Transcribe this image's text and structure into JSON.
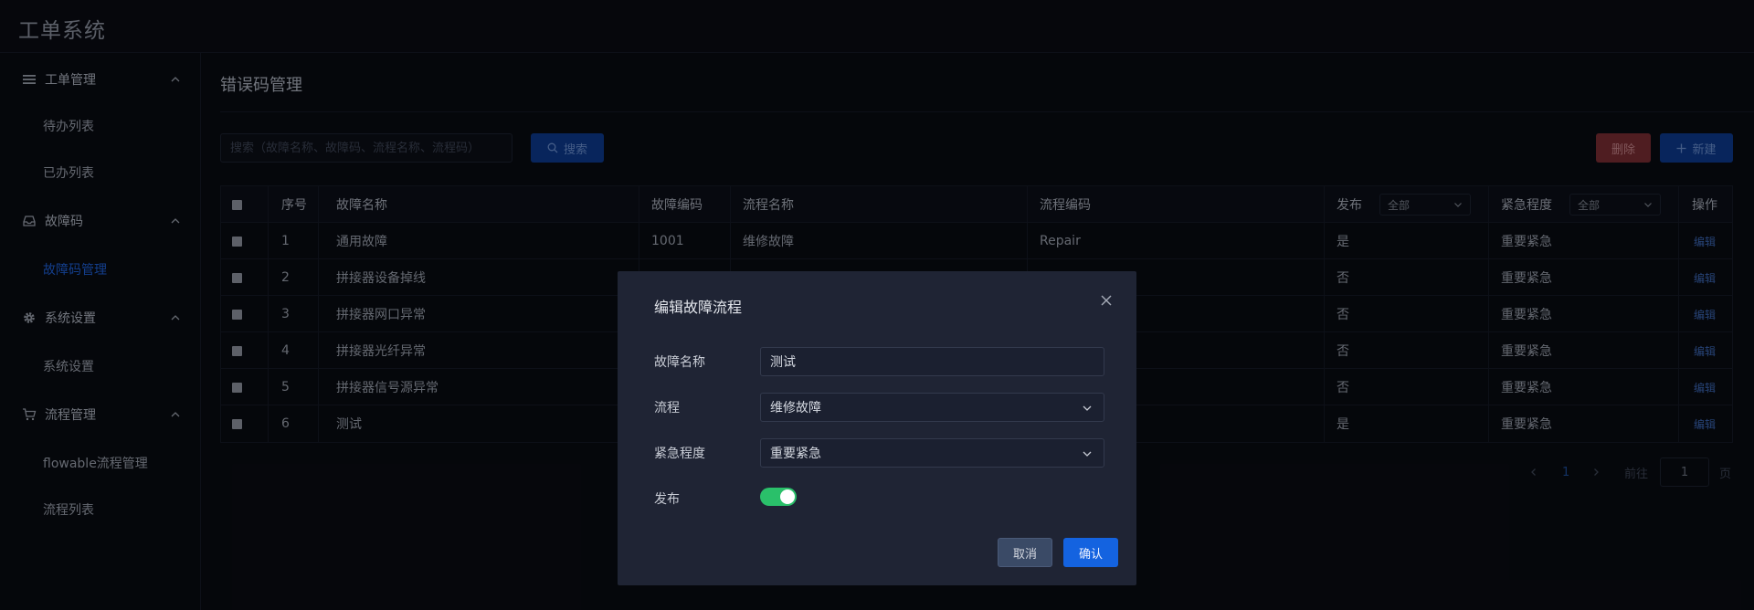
{
  "app": {
    "title": "工单系统"
  },
  "sidebar": {
    "groups": [
      {
        "label": "工单管理",
        "icon": "list-icon",
        "items": [
          {
            "label": "待办列表"
          },
          {
            "label": "已办列表"
          }
        ]
      },
      {
        "label": "故障码",
        "icon": "inbox-icon",
        "items": [
          {
            "label": "故障码管理",
            "active": true
          }
        ]
      },
      {
        "label": "系统设置",
        "icon": "gear-icon",
        "items": [
          {
            "label": "系统设置"
          }
        ]
      },
      {
        "label": "流程管理",
        "icon": "cart-icon",
        "items": [
          {
            "label": "flowable流程管理"
          },
          {
            "label": "流程列表"
          }
        ]
      }
    ]
  },
  "page": {
    "title": "错误码管理",
    "search": {
      "placeholder": "搜索（故障名称、故障码、流程名称、流程码）",
      "value": ""
    },
    "search_button": "搜索",
    "delete_button": "删除",
    "new_button": "新建"
  },
  "table": {
    "headers": {
      "index": "序号",
      "fault_name": "故障名称",
      "fault_code": "故障编码",
      "flow_name": "流程名称",
      "flow_code": "流程编码",
      "publish": "发布",
      "urgency": "紧急程度",
      "action": "操作"
    },
    "publish_filter": "全部",
    "urgency_filter": "全部",
    "rows": [
      {
        "index": "1",
        "fault_name": "通用故障",
        "fault_code": "1001",
        "flow_name": "维修故障",
        "flow_code": "Repair",
        "publish": "是",
        "urgency": "重要紧急",
        "action": "编辑"
      },
      {
        "index": "2",
        "fault_name": "拼接器设备掉线",
        "fault_code": "",
        "flow_name": "",
        "flow_code": "",
        "publish": "否",
        "urgency": "重要紧急",
        "action": "编辑"
      },
      {
        "index": "3",
        "fault_name": "拼接器网口异常",
        "fault_code": "",
        "flow_name": "",
        "flow_code": "",
        "publish": "否",
        "urgency": "重要紧急",
        "action": "编辑"
      },
      {
        "index": "4",
        "fault_name": "拼接器光纤异常",
        "fault_code": "",
        "flow_name": "",
        "flow_code": "",
        "publish": "否",
        "urgency": "重要紧急",
        "action": "编辑"
      },
      {
        "index": "5",
        "fault_name": "拼接器信号源异常",
        "fault_code": "",
        "flow_name": "",
        "flow_code": "",
        "publish": "否",
        "urgency": "重要紧急",
        "action": "编辑"
      },
      {
        "index": "6",
        "fault_name": "测试",
        "fault_code": "",
        "flow_name": "",
        "flow_code": "",
        "publish": "是",
        "urgency": "重要紧急",
        "action": "编辑"
      }
    ]
  },
  "pagination": {
    "current": "1",
    "goto_label": "前往",
    "goto_value": "1",
    "page_suffix": "页"
  },
  "dialog": {
    "title": "编辑故障流程",
    "fault_name_label": "故障名称",
    "fault_name_value": "测试",
    "flow_label": "流程",
    "flow_value": "维修故障",
    "urgency_label": "紧急程度",
    "urgency_value": "重要紧急",
    "publish_label": "发布",
    "publish_on": true,
    "cancel": "取消",
    "confirm": "确认"
  },
  "colors": {
    "accent": "#1463e0",
    "danger": "#7a2d33",
    "toggle_on": "#2ac06a",
    "background": "#090b12",
    "dialog_bg": "#1f2434"
  }
}
